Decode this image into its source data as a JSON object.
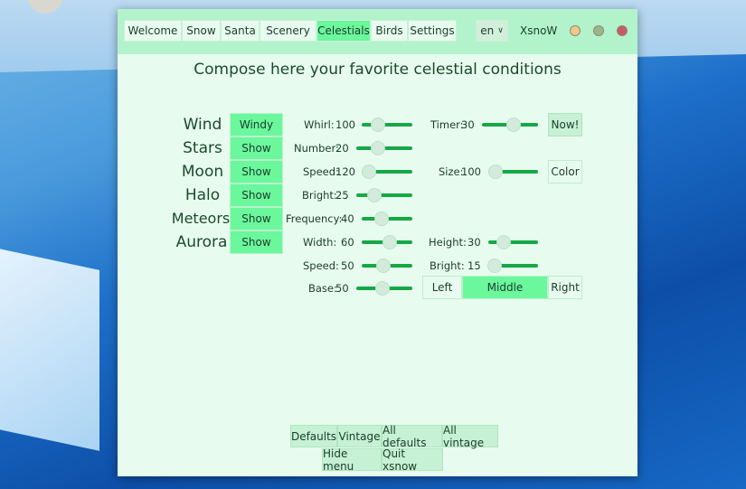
{
  "tabs": [
    "Welcome",
    "Snow",
    "Santa",
    "Scenery",
    "Celestials",
    "Birds",
    "Settings"
  ],
  "active_tab": "Celestials",
  "language": "en",
  "app_name": "XsnoW",
  "heading": "Compose here your favorite celestial conditions",
  "rows": [
    {
      "label": "Wind",
      "button": "Windy"
    },
    {
      "label": "Stars",
      "button": "Show"
    },
    {
      "label": "Moon",
      "button": "Show"
    },
    {
      "label": "Halo",
      "button": "Show"
    },
    {
      "label": "Meteors",
      "button": "Show"
    },
    {
      "label": "Aurora",
      "button": "Show"
    }
  ],
  "sliders": {
    "whirl": {
      "label": "Whirl:",
      "value": "100",
      "fraction": 0.33
    },
    "timer": {
      "label": "Timer:",
      "value": "30",
      "fraction": 0.56
    },
    "number": {
      "label": "Number:",
      "value": "20",
      "fraction": 0.39
    },
    "moon_speed": {
      "label": "Speed:",
      "value": "120",
      "fraction": 0.14
    },
    "moon_size": {
      "label": "Size:",
      "value": "100",
      "fraction": 0.15
    },
    "halo_bright": {
      "label": "Bright:",
      "value": "25",
      "fraction": 0.32
    },
    "frequency": {
      "label": "Frequency:",
      "value": "40",
      "fraction": 0.39
    },
    "aurora_width": {
      "label": "Width:",
      "value": "60",
      "fraction": 0.55
    },
    "aurora_height": {
      "label": "Height:",
      "value": "30",
      "fraction": 0.3
    },
    "aurora_speed": {
      "label": "Speed:",
      "value": "50",
      "fraction": 0.43
    },
    "aurora_bright": {
      "label": "Bright:",
      "value": "15",
      "fraction": 0.12
    },
    "aurora_base": {
      "label": "Base:",
      "value": "50",
      "fraction": 0.47
    }
  },
  "now_button": "Now!",
  "color_button": "Color",
  "align": {
    "left": "Left",
    "middle": "Middle",
    "right": "Right",
    "selected": "Middle"
  },
  "bottom": {
    "defaults": "Defaults",
    "vintage": "Vintage",
    "all_defaults": "All defaults",
    "all_vintage": "All vintage",
    "hide_menu": "Hide menu",
    "quit": "Quit xsnow"
  }
}
